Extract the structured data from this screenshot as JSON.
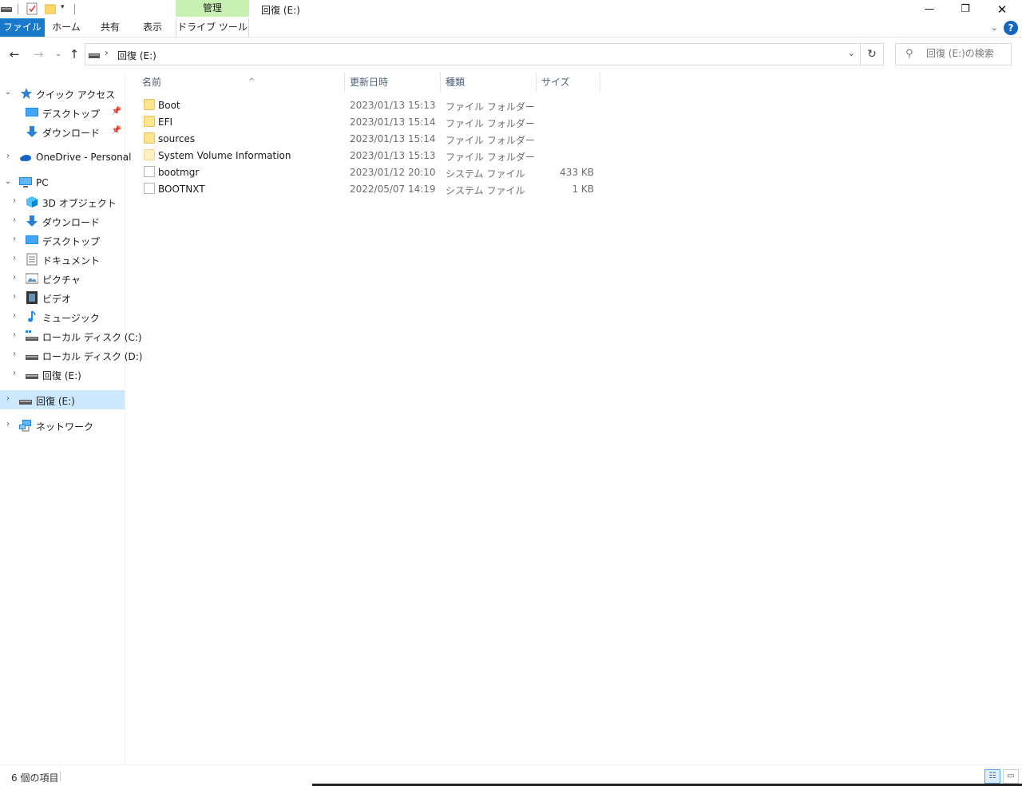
{
  "window": {
    "title": "回復 (E:)",
    "context_group": "管理",
    "tabs": [
      {
        "label": "ファイル"
      },
      {
        "label": "ホーム"
      },
      {
        "label": "共有"
      },
      {
        "label": "表示"
      },
      {
        "label": "ドライブ ツール"
      }
    ],
    "minimize": "—",
    "restore": "❐",
    "close": "✕",
    "help": "?"
  },
  "address": {
    "path": "回復 (E:)",
    "search_placeholder": "回復 (E:)の検索"
  },
  "sidebar": {
    "items": [
      {
        "label": "クイック アクセス",
        "icon": "star-icon"
      },
      {
        "label": "デスクトップ",
        "icon": "desktop-icon",
        "pinned": true
      },
      {
        "label": "ダウンロード",
        "icon": "download-icon",
        "pinned": true
      },
      {
        "label": "OneDrive - Personal",
        "icon": "cloud-icon"
      },
      {
        "label": "PC",
        "icon": "pc-icon"
      },
      {
        "label": "3D オブジェクト",
        "icon": "cube-icon"
      },
      {
        "label": "ダウンロード",
        "icon": "download-icon"
      },
      {
        "label": "デスクトップ",
        "icon": "desktop-icon"
      },
      {
        "label": "ドキュメント",
        "icon": "document-icon"
      },
      {
        "label": "ピクチャ",
        "icon": "picture-icon"
      },
      {
        "label": "ビデオ",
        "icon": "video-icon"
      },
      {
        "label": "ミュージック",
        "icon": "music-icon"
      },
      {
        "label": "ローカル ディスク (C:)",
        "icon": "drive-icon"
      },
      {
        "label": "ローカル ディスク (D:)",
        "icon": "drive-icon"
      },
      {
        "label": "回復 (E:)",
        "icon": "drive-icon"
      },
      {
        "label": "回復 (E:)",
        "icon": "drive-icon",
        "selected": true
      },
      {
        "label": "ネットワーク",
        "icon": "network-icon"
      }
    ]
  },
  "columns": {
    "name": "名前",
    "date": "更新日時",
    "type": "種類",
    "size": "サイズ"
  },
  "files": [
    {
      "name": "Boot",
      "date": "2023/01/13 15:13",
      "type": "ファイル フォルダー",
      "size": "",
      "kind": "folder"
    },
    {
      "name": "EFI",
      "date": "2023/01/13 15:14",
      "type": "ファイル フォルダー",
      "size": "",
      "kind": "folder"
    },
    {
      "name": "sources",
      "date": "2023/01/13 15:14",
      "type": "ファイル フォルダー",
      "size": "",
      "kind": "folder"
    },
    {
      "name": "System Volume Information",
      "date": "2023/01/13 15:13",
      "type": "ファイル フォルダー",
      "size": "",
      "kind": "folder-hidden"
    },
    {
      "name": "bootmgr",
      "date": "2023/01/12 20:10",
      "type": "システム ファイル",
      "size": "433 KB",
      "kind": "system"
    },
    {
      "name": "BOOTNXT",
      "date": "2022/05/07 14:19",
      "type": "システム ファイル",
      "size": "1 KB",
      "kind": "system"
    }
  ],
  "status": {
    "item_count": "6 個の項目"
  },
  "colors": {
    "file_tab": "#1979ca",
    "context_tab": "#c9f0b3",
    "selection": "#cce8ff",
    "header_text": "#4c607a"
  }
}
